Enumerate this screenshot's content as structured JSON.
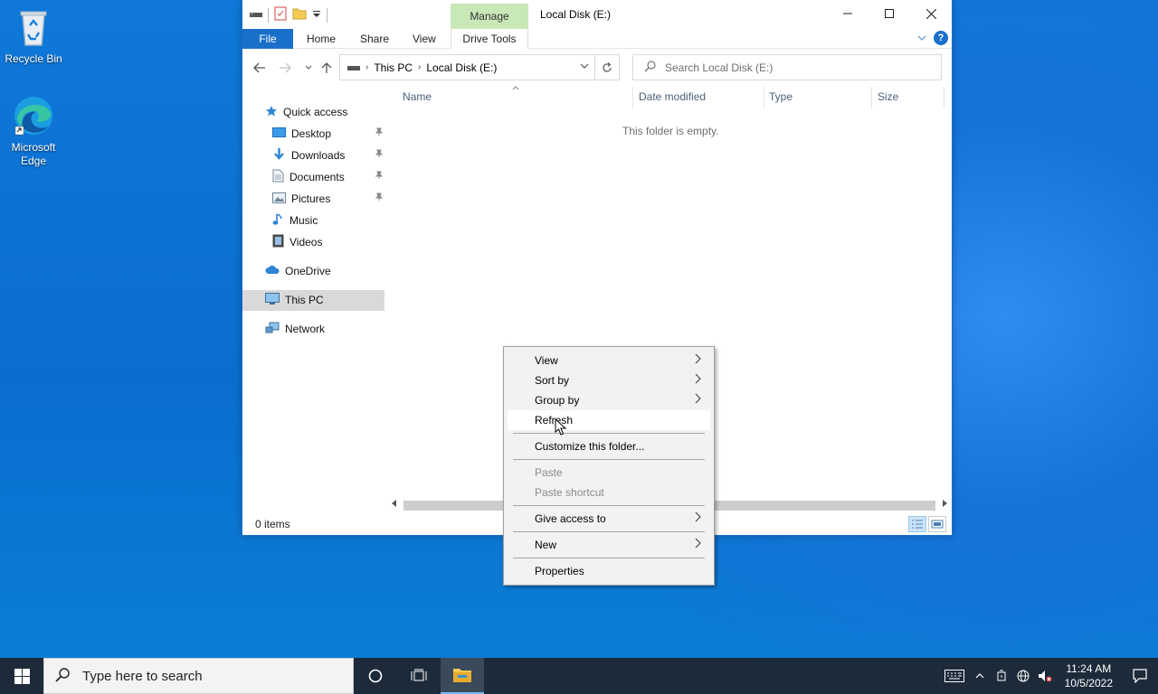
{
  "desktop": {
    "icons": [
      {
        "label": "Recycle Bin"
      },
      {
        "label": "Microsoft Edge"
      }
    ]
  },
  "window": {
    "title": "Local Disk (E:)",
    "contextual_tab_group": "Manage",
    "ribbon_tabs": {
      "file": "File",
      "home": "Home",
      "share": "Share",
      "view": "View",
      "drive_tools": "Drive Tools"
    },
    "breadcrumb": {
      "part1": "This PC",
      "part2": "Local Disk (E:)"
    },
    "search_placeholder": "Search Local Disk (E:)",
    "columns": {
      "name": "Name",
      "date_modified": "Date modified",
      "type": "Type",
      "size": "Size"
    },
    "empty_message": "This folder is empty.",
    "status": "0 items",
    "nav": {
      "quick_access": "Quick access",
      "desktop": "Desktop",
      "downloads": "Downloads",
      "documents": "Documents",
      "pictures": "Pictures",
      "music": "Music",
      "videos": "Videos",
      "onedrive": "OneDrive",
      "this_pc": "This PC",
      "network": "Network"
    }
  },
  "context_menu": {
    "view": "View",
    "sort_by": "Sort by",
    "group_by": "Group by",
    "refresh": "Refresh",
    "customize": "Customize this folder...",
    "paste": "Paste",
    "paste_shortcut": "Paste shortcut",
    "give_access": "Give access to",
    "new": "New",
    "properties": "Properties"
  },
  "taskbar": {
    "search_placeholder": "Type here to search",
    "time": "11:24 AM",
    "date": "10/5/2022"
  },
  "colors": {
    "accent": "#1a6fc9",
    "manage_tab": "#c9e8b8",
    "taskbar": "#1c2a3a"
  }
}
